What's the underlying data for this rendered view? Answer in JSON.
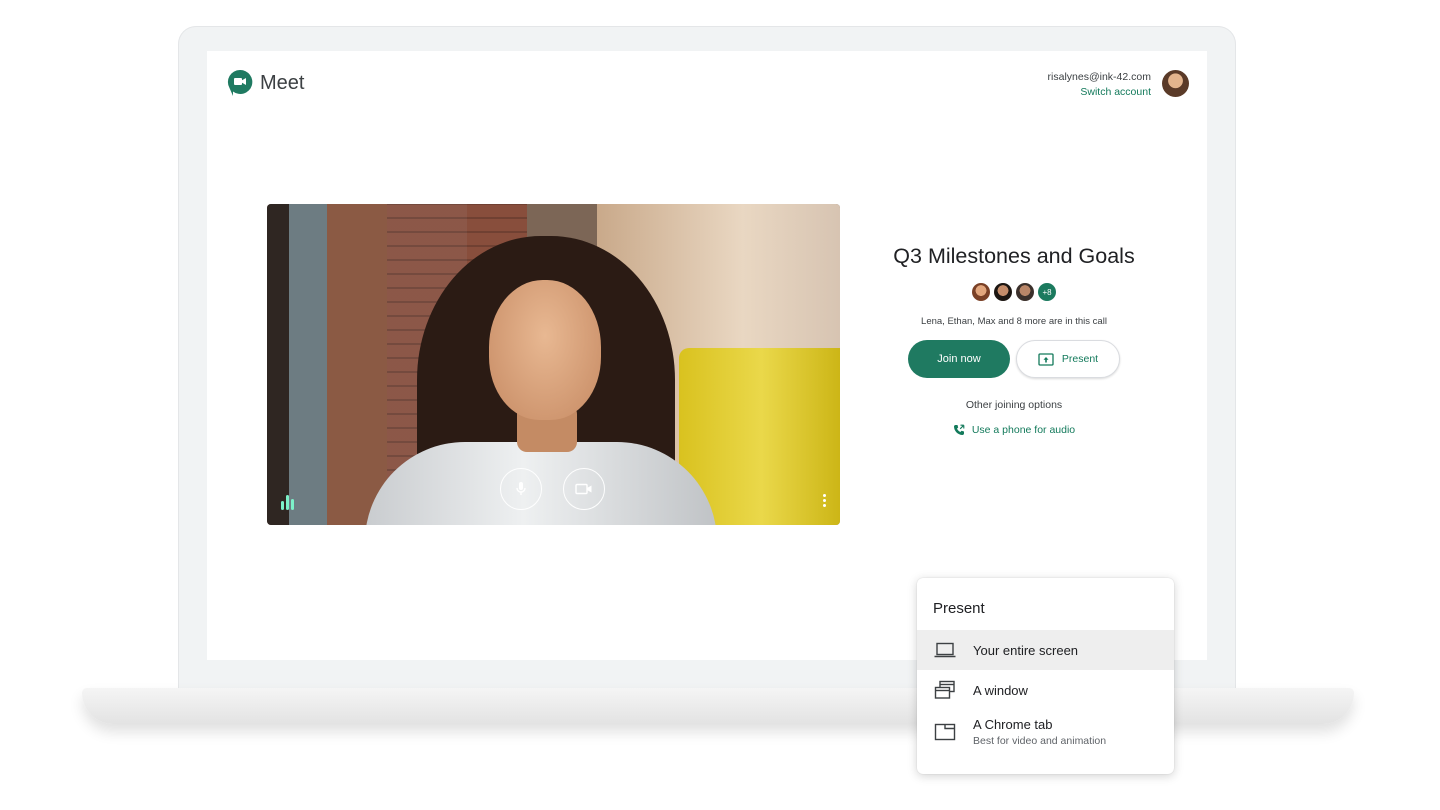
{
  "app": {
    "name": "Meet",
    "brand_color": "#1f7a61"
  },
  "account": {
    "email": "risalynes@ink-42.com",
    "switch_label": "Switch account"
  },
  "meeting": {
    "title": "Q3 Milestones and Goals",
    "extra_participants": "+8",
    "in_call_text": "Lena, Ethan, Max and 8 more are in this call",
    "join_label": "Join now",
    "present_label": "Present",
    "other_options_label": "Other joining options",
    "phone_audio_label": "Use a phone for audio"
  },
  "video_controls": {
    "mic_icon": "microphone-icon",
    "camera_icon": "camera-icon",
    "more_icon": "more-vert-icon",
    "audio_level_icon": "audio-level-icon"
  },
  "present_menu": {
    "title": "Present",
    "items": [
      {
        "label": "Your entire screen",
        "sublabel": "",
        "icon": "laptop-icon",
        "selected": true
      },
      {
        "label": "A window",
        "sublabel": "",
        "icon": "window-icon",
        "selected": false
      },
      {
        "label": "A Chrome tab",
        "sublabel": "Best for video and animation",
        "icon": "tab-icon",
        "selected": false
      }
    ]
  }
}
